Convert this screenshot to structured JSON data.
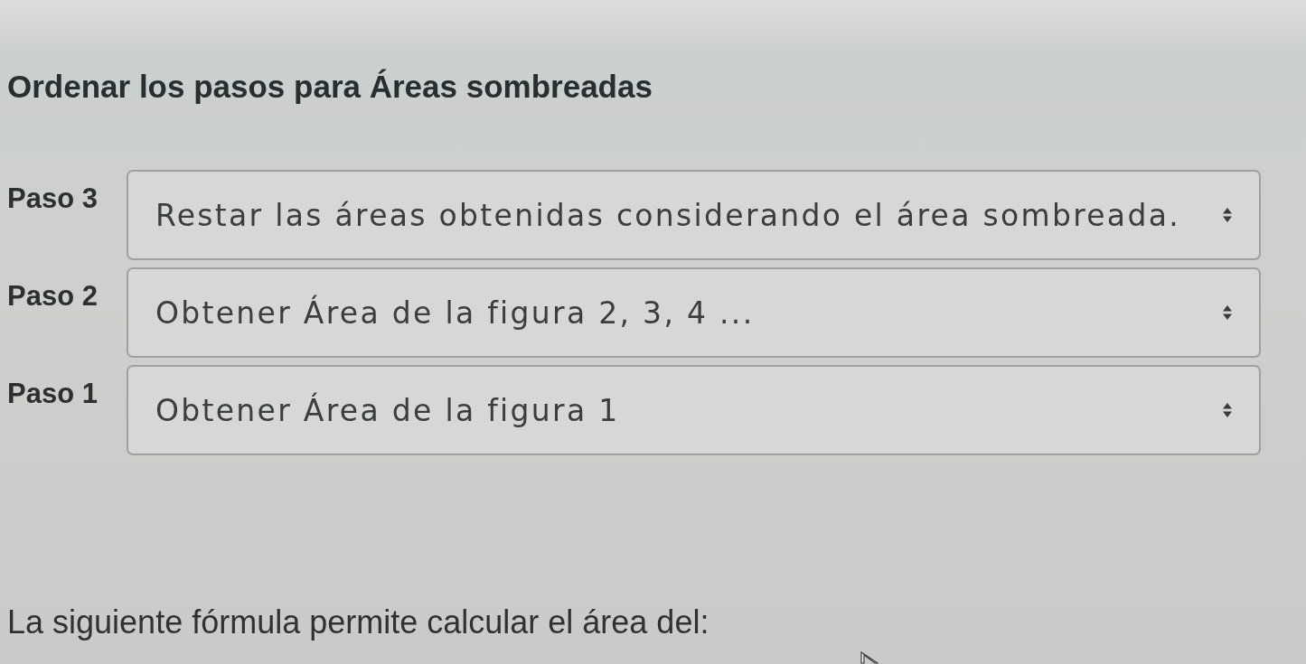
{
  "title": "Ordenar los pasos para Áreas sombreadas",
  "steps": [
    {
      "label": "Paso 3",
      "value": "Restar las áreas obtenidas considerando el área sombreada."
    },
    {
      "label": "Paso 2",
      "value": "Obtener Área de la figura 2, 3, 4 ..."
    },
    {
      "label": "Paso 1",
      "value": "Obtener Área de la figura 1"
    }
  ],
  "question": {
    "text": "La siguiente fórmula permite calcular el área del:"
  }
}
